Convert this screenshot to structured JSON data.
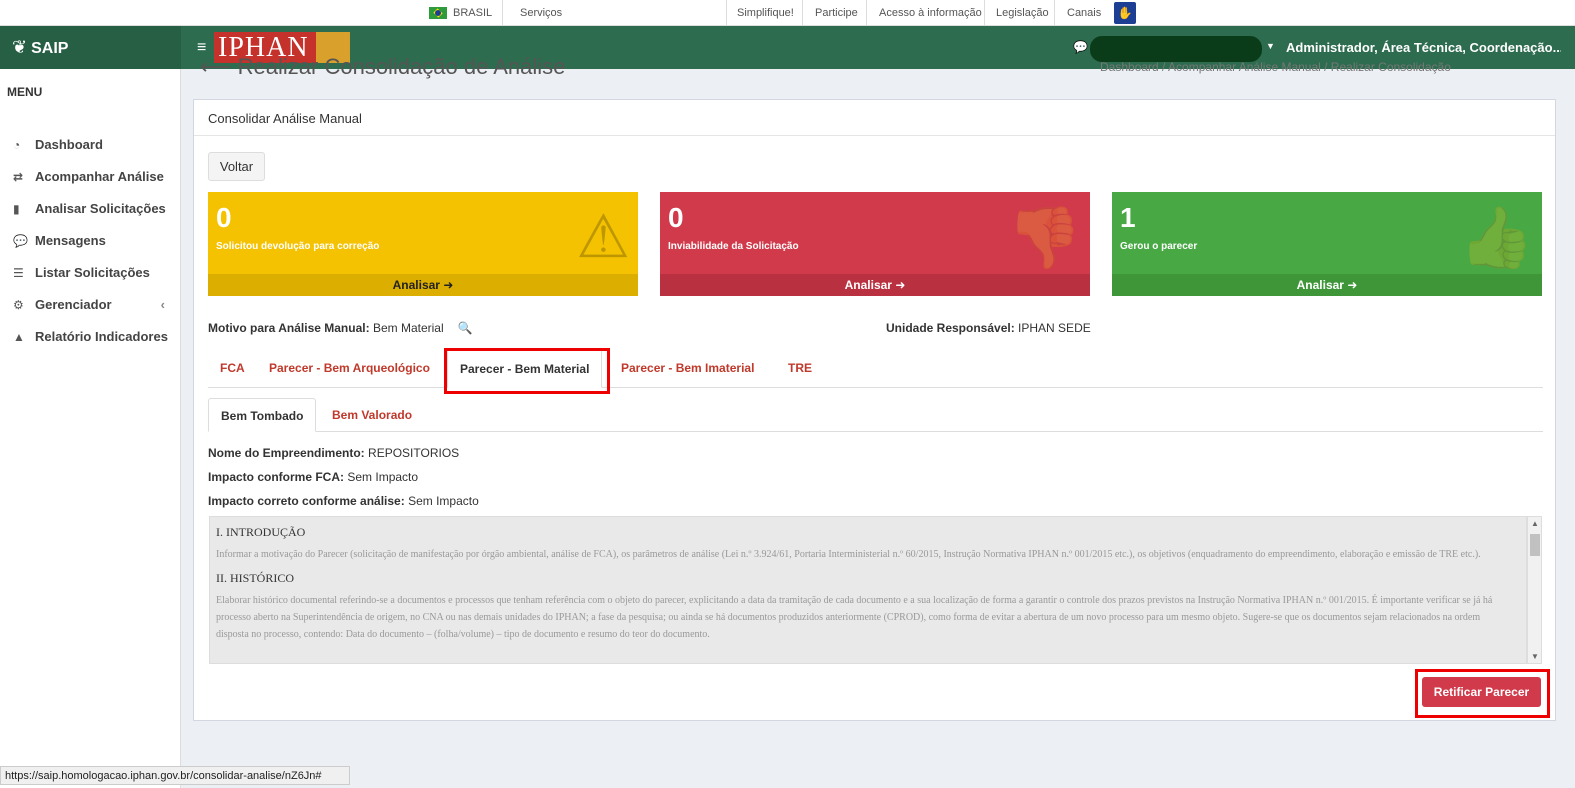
{
  "govbar": {
    "country": "BRASIL",
    "services": "Serviços",
    "links": [
      "Simplifique!",
      "Participe",
      "Acesso à informação",
      "Legislação",
      "Canais"
    ]
  },
  "header": {
    "brand": "SAIP",
    "logo_text": "IPHAN",
    "user": "Administrador, Área Técnica, Coordenação..."
  },
  "sidebar": {
    "title": "MENU",
    "items": [
      {
        "label": "Dashboard",
        "icon": "dashboard-icon"
      },
      {
        "label": "Acompanhar Análise",
        "icon": "exchange-icon"
      },
      {
        "label": "Analisar Solicitações",
        "icon": "book-icon"
      },
      {
        "label": "Mensagens",
        "icon": "comments-icon"
      },
      {
        "label": "Listar Solicitações",
        "icon": "list-icon"
      },
      {
        "label": "Gerenciador",
        "icon": "gears-icon"
      },
      {
        "label": "Relatório Indicadores",
        "icon": "area-chart-icon"
      }
    ]
  },
  "page": {
    "title": "Realizar Consolidação de Análise",
    "breadcrumb": "Dashboard / Acompanhar Análise Manual / Realizar Consolidação"
  },
  "box": {
    "title": "Consolidar Análise Manual",
    "back_label": "Voltar",
    "stats": [
      {
        "count": "0",
        "label": "Solicitou devolução para correção",
        "action": "Analisar ➜",
        "color": "#f4c200"
      },
      {
        "count": "0",
        "label": "Inviabilidade da Solicitação",
        "action": "Analisar ➜",
        "color": "#d03a4a"
      },
      {
        "count": "1",
        "label": "Gerou o parecer",
        "action": "Analisar ➜",
        "color": "#48a843"
      }
    ],
    "motivo_label": "Motivo para Análise Manual:",
    "motivo_value": "Bem Material",
    "unidade_label": "Unidade Responsável:",
    "unidade_value": "IPHAN SEDE",
    "tabs": [
      "FCA",
      "Parecer - Bem Arqueológico",
      "Parecer - Bem Material",
      "Parecer - Bem Imaterial",
      "TRE"
    ],
    "subtabs": [
      "Bem Tombado",
      "Bem Valorado"
    ],
    "fields": [
      {
        "label": "Nome do Empreendimento:",
        "value": "REPOSITORIOS"
      },
      {
        "label": "Impacto conforme FCA:",
        "value": "Sem Impacto"
      },
      {
        "label": "Impacto correto conforme análise:",
        "value": "Sem Impacto"
      }
    ],
    "doc": {
      "h1": "I. INTRODUÇÃO",
      "p1": "Informar a motivação do Parecer (solicitação de manifestação por órgão ambiental, análise de FCA), os parâmetros de análise (Lei n.º 3.924/61, Portaria Interministerial n.º 60/2015, Instrução Normativa IPHAN n.º 001/2015 etc.), os objetivos (enquadramento do empreendimento, elaboração e emissão de TRE etc.).",
      "h2": "II. HISTÓRICO",
      "p2": "Elaborar histórico documental referindo-se a documentos e processos que tenham referência com o objeto do parecer, explicitando a data da tramitação de cada documento e a sua localização de forma a garantir o controle dos prazos previstos na Instrução Normativa IPHAN n.º 001/2015. É importante verificar se já há processo aberto na Superintendência de origem, no CNA ou nas demais unidades do IPHAN; a fase da pesquisa; ou ainda se há documentos produzidos anteriormente (CPROD), como forma de evitar a abertura de um novo processo para um mesmo objeto. Sugere-se que os documentos sejam relacionados na ordem disposta no processo, contendo: Data do documento – (folha/volume) – tipo de documento e resumo do teor do documento."
    },
    "rectify_label": "Retificar Parecer"
  },
  "statusbar": "https://saip.homologacao.iphan.gov.br/consolidar-analise/nZ6Jn#"
}
